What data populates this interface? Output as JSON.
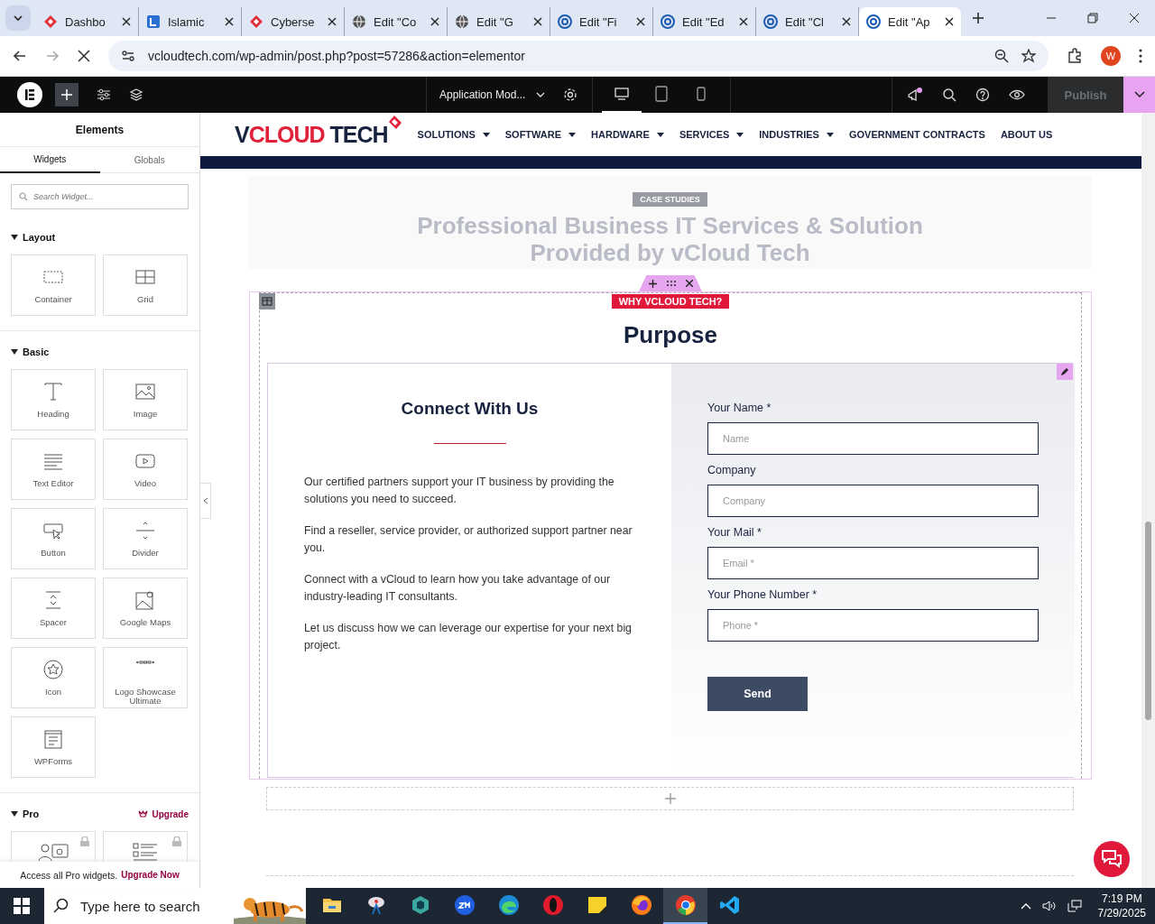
{
  "browser": {
    "tabs": [
      {
        "title": "Dashbo",
        "kind": "diamond",
        "selected": false
      },
      {
        "title": "Islamic",
        "kind": "square",
        "selected": false
      },
      {
        "title": "Cyberse",
        "kind": "diamond",
        "selected": false
      },
      {
        "title": "Edit \"Co",
        "kind": "globe",
        "selected": false
      },
      {
        "title": "Edit \"G",
        "kind": "globe",
        "selected": false
      },
      {
        "title": "Edit \"Fi",
        "kind": "swirl",
        "selected": false
      },
      {
        "title": "Edit \"Ed",
        "kind": "swirl",
        "selected": false
      },
      {
        "title": "Edit \"Cl",
        "kind": "swirl",
        "selected": false
      },
      {
        "title": "Edit \"Ap",
        "kind": "swirl",
        "selected": true
      }
    ],
    "url": "vcloudtech.com/wp-admin/post.php?post=57286&action=elementor",
    "profile": "W"
  },
  "editor_bar": {
    "document": "Application Mod...",
    "devices": [
      {
        "kind": "desktop",
        "selected": true
      },
      {
        "kind": "tablet",
        "selected": false
      },
      {
        "kind": "mobile",
        "selected": false
      }
    ],
    "publish": {
      "label": "Publish",
      "disabled": true
    }
  },
  "panel": {
    "title": "Elements",
    "tabs": [
      {
        "label": "Widgets",
        "selected": true
      },
      {
        "label": "Globals",
        "selected": false
      }
    ],
    "search": {
      "placeholder": "Search Widget..."
    },
    "sections": [
      {
        "title": "Layout",
        "widgets": [
          {
            "label": "Container",
            "kind": "container"
          },
          {
            "label": "Grid",
            "kind": "grid"
          }
        ]
      },
      {
        "title": "Basic",
        "widgets": [
          {
            "label": "Heading",
            "kind": "heading"
          },
          {
            "label": "Image"
          },
          {
            "label": "Text Editor",
            "kind": "text"
          },
          {
            "label": "Video",
            "kind": "video"
          },
          {
            "label": "Button",
            "kind": "button"
          },
          {
            "label": "Divider",
            "kind": "divider"
          },
          {
            "label": "Spacer",
            "kind": "spacer"
          },
          {
            "label": "Google Maps",
            "kind": "map"
          },
          {
            "label": "Icon",
            "kind": "star"
          },
          {
            "label": "Logo Showcase Ultimate",
            "kind": "logos"
          },
          {
            "label": "WPForms",
            "kind": "form"
          }
        ]
      }
    ],
    "pro": {
      "title": "Pro",
      "upgrade": "Upgrade",
      "widgets": [
        {
          "kind": "people",
          "locked": true
        },
        {
          "kind": "list",
          "locked": true
        }
      ]
    },
    "footer": {
      "text": "Access all Pro widgets.",
      "link": "Upgrade Now"
    }
  },
  "site": {
    "logo": [
      "V",
      "CLOUD",
      " TECH"
    ],
    "nav": [
      {
        "label": "SOLUTIONS",
        "dropdown": true
      },
      {
        "label": "SOFTWARE",
        "dropdown": true
      },
      {
        "label": "HARDWARE",
        "dropdown": true
      },
      {
        "label": "SERVICES",
        "dropdown": true
      },
      {
        "label": "INDUSTRIES",
        "dropdown": true
      },
      {
        "label": "GOVERNMENT CONTRACTS",
        "dropdown": false
      },
      {
        "label": "ABOUT US",
        "dropdown": false
      }
    ],
    "hero": {
      "badge": "CASE STUDIES",
      "title": [
        "Professional Business IT Services & Solution",
        "Provided by vCloud Tech"
      ]
    },
    "section": {
      "tag": "WHY VCLOUD TECH?",
      "heading": "Purpose",
      "left": {
        "heading": "Connect With Us",
        "paragraphs": [
          "Our certified partners support your IT business by providing the solutions you need to succeed.",
          "Find a reseller, service provider, or authorized support partner near you.",
          "Connect with a vCloud to learn how you take advantage of our industry-leading IT consultants.",
          "Let us discuss how we can leverage our expertise for your next big project."
        ]
      },
      "form": {
        "fields": [
          {
            "label": "Your Name *",
            "placeholder": "Name"
          },
          {
            "label": "Company",
            "placeholder": "Company"
          },
          {
            "label": "Your Mail *",
            "placeholder": "Email *"
          },
          {
            "label": "Your Phone Number *",
            "placeholder": "Phone *"
          }
        ],
        "button": "Send"
      }
    }
  },
  "taskbar": {
    "search": {
      "placeholder": "Type here to search"
    },
    "apps": [
      {
        "kind": "folder",
        "selected": false
      },
      {
        "kind": "snip",
        "selected": false
      },
      {
        "kind": "hex",
        "selected": false
      },
      {
        "kind": "zoom",
        "selected": false
      },
      {
        "kind": "edge",
        "selected": false
      },
      {
        "kind": "opera",
        "selected": false
      },
      {
        "kind": "notes",
        "selected": false
      },
      {
        "kind": "firefox",
        "selected": false
      },
      {
        "kind": "chrome",
        "selected": true
      },
      {
        "kind": "vscode",
        "selected": false
      }
    ],
    "time": "7:19 PM",
    "date": "7/29/2025"
  }
}
